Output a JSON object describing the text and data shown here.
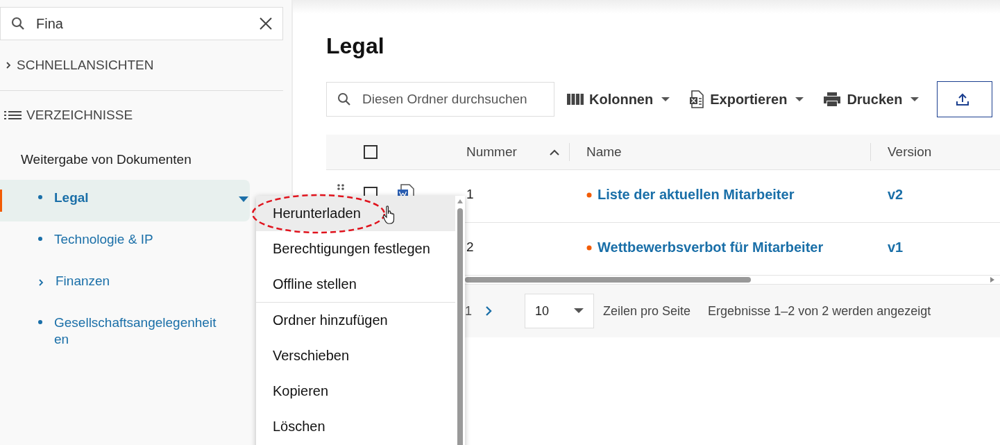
{
  "sidebar": {
    "search": {
      "value": "Fina"
    },
    "sections": [
      {
        "kind": "collapsed",
        "label": "SCHNELLANSICHTEN"
      },
      {
        "kind": "list",
        "label": "VERZEICHNISSE"
      }
    ],
    "root": "Weitergabe von Dokumenten",
    "folders": [
      {
        "kind": "bullet",
        "label": "Legal",
        "selected": true
      },
      {
        "kind": "bullet",
        "label": "Technologie & IP",
        "selected": false
      },
      {
        "kind": "chevron",
        "label": "Finanzen",
        "selected": false
      },
      {
        "kind": "bullet",
        "label": "Gesellschaftsangelegenheiten",
        "selected": false
      }
    ]
  },
  "main": {
    "title": "Legal",
    "toolbar": {
      "search": {
        "placeholder": "Diesen Ordner durchsuchen"
      },
      "buttons": [
        {
          "kind": "columns",
          "label": "Kolonnen"
        },
        {
          "kind": "export",
          "label": "Exportieren"
        },
        {
          "kind": "print",
          "label": "Drucken"
        },
        {
          "kind": "upload"
        }
      ]
    },
    "table": {
      "columns": [
        "Nummer",
        "Name",
        "Version"
      ],
      "select_all_checked": false,
      "rows": [
        {
          "checked": false,
          "number": "1",
          "name": "Liste der aktuellen Mitarbeiter",
          "version": "v2"
        },
        {
          "number": "2",
          "name": "Wettbewerbsverbot für Mitarbeiter",
          "version": "v1"
        }
      ]
    },
    "pagination": {
      "page": "1",
      "rows_per_page": "10",
      "rows_label": "Zeilen pro Seite",
      "results": "Ergebnisse 1–2 von 2 werden angezeigt"
    }
  },
  "context_menu": {
    "items": [
      {
        "label": "Herunterladen",
        "selected": true,
        "divider_after": false
      },
      {
        "label": "Berechtigungen festlegen",
        "selected": false,
        "divider_after": false
      },
      {
        "label": "Offline stellen",
        "selected": false,
        "divider_after": true
      },
      {
        "label": "Ordner hinzufügen",
        "selected": false,
        "divider_after": false
      },
      {
        "label": "Verschieben",
        "selected": false,
        "divider_after": false
      },
      {
        "label": "Kopieren",
        "selected": false,
        "divider_after": false
      },
      {
        "label": "Löschen",
        "selected": false,
        "divider_after": false
      }
    ]
  }
}
